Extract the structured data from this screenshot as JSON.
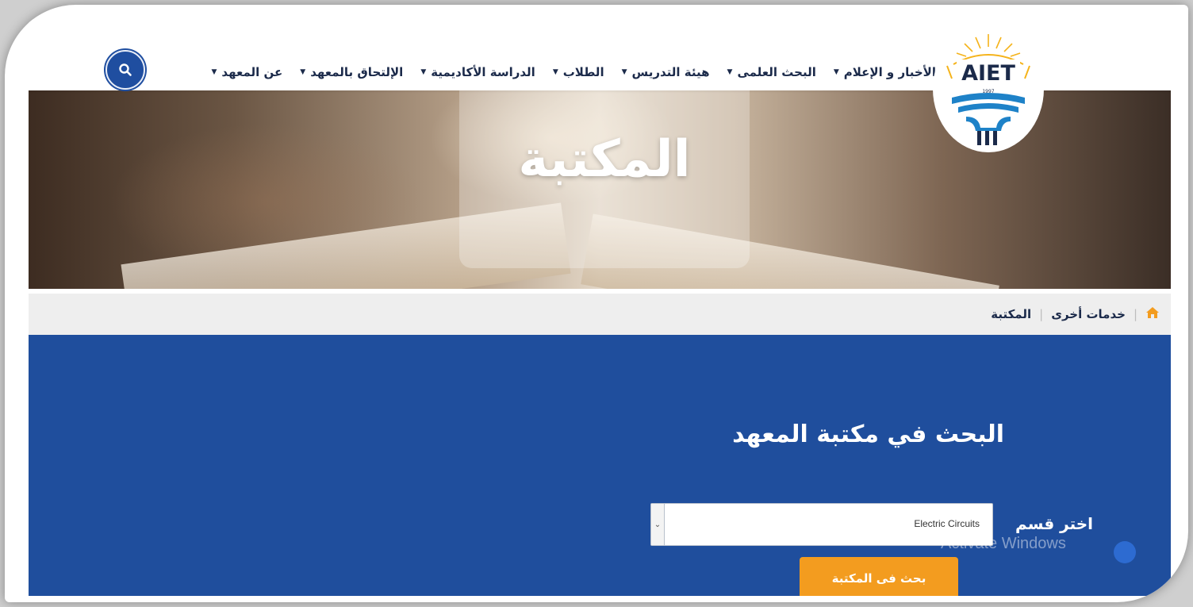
{
  "logo": {
    "text": "AIET",
    "year": "1997"
  },
  "nav": {
    "items": [
      {
        "label": "عن المعهد"
      },
      {
        "label": "الإلتحاق بالمعهد"
      },
      {
        "label": "الدراسة الأكاديمية"
      },
      {
        "label": "الطلاب"
      },
      {
        "label": "هيئة التدريس"
      },
      {
        "label": "البحث العلمى"
      },
      {
        "label": "الأخبار و الإعلام"
      }
    ],
    "search_icon": "search-icon"
  },
  "hero": {
    "title": "المكتبة"
  },
  "breadcrumb": {
    "home_icon": "home-icon",
    "items": [
      "خدمات أخرى",
      "المكتبة"
    ]
  },
  "library_search": {
    "title": "البحث في مكتبة المعهد",
    "select_label": "اختر قسم",
    "selected_department": "Electric Circuits",
    "button_label": "بحث فى المكتبة"
  },
  "overlay": {
    "watermark": "Activate Windows"
  },
  "colors": {
    "primary": "#1f4e9d",
    "accent": "#f39c1f",
    "crumb_bg": "#eeeeee"
  }
}
